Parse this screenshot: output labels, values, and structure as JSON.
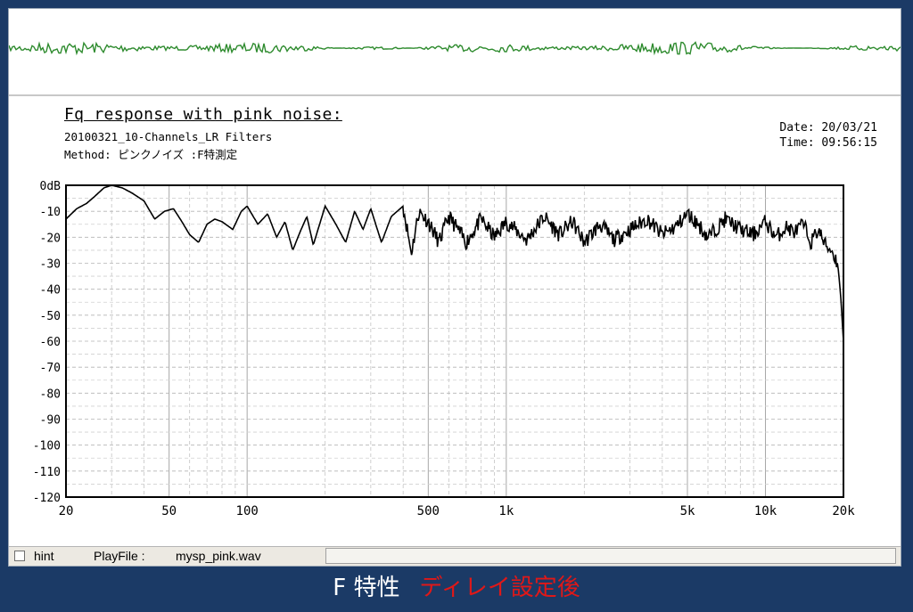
{
  "report": {
    "title": "Fq response with pink noise:",
    "subtitle": "20100321_10-Channels_LR Filters",
    "method": "Method: ピンクノイズ :F特測定",
    "date": "Date: 20/03/21",
    "time": "Time: 09:56:15"
  },
  "statusbar": {
    "hint_label": "hint",
    "playfile_label": "PlayFile :",
    "playfile_value": "mysp_pink.wav",
    "status_text": ""
  },
  "caption": {
    "main": "F 特性",
    "accent": "ディレイ設定後"
  },
  "colors": {
    "background": "#1b3a66",
    "waveform": "#2e8b2e",
    "curve": "#000000",
    "caption_main": "#ffffff",
    "caption_accent": "#e01818"
  },
  "chart_data": {
    "type": "line",
    "title": "Fq response with pink noise:",
    "xscale": "log",
    "xlim": [
      20,
      20000
    ],
    "ylim": [
      -120,
      0
    ],
    "grid": true,
    "yticks": [
      0,
      -10,
      -20,
      -30,
      -40,
      -50,
      -60,
      -70,
      -80,
      -90,
      -100,
      -110,
      -120
    ],
    "ytick_labels": [
      "0dB",
      "-10",
      "-20",
      "-30",
      "-40",
      "-50",
      "-60",
      "-70",
      "-80",
      "-90",
      "-100",
      "-110",
      "-120"
    ],
    "xticks": [
      20,
      50,
      100,
      500,
      1000,
      5000,
      10000,
      20000
    ],
    "xtick_labels": [
      "20",
      "50",
      "100",
      "500",
      "1k",
      "5k",
      "10k",
      "20k"
    ],
    "series": [
      {
        "x": [
          20,
          22,
          24,
          26,
          28,
          30,
          33,
          36,
          40,
          44,
          48,
          52,
          56,
          60,
          65,
          70,
          75,
          80,
          88,
          95,
          100,
          110,
          120,
          130,
          140,
          150,
          160,
          170,
          180,
          200,
          220,
          240,
          260,
          280,
          300,
          330,
          360,
          400,
          430,
          460,
          500,
          550,
          600,
          650,
          700,
          800,
          900,
          1000,
          1200,
          1400,
          1600,
          1800,
          2000,
          2300,
          2600,
          3000,
          3500,
          4000,
          4500,
          5000,
          5500,
          6000,
          7000,
          8000,
          9000,
          10000,
          11000,
          12000,
          13000,
          14000,
          15000,
          16000,
          17000,
          18000,
          19000,
          19500,
          20000
        ],
        "y": [
          -13,
          -9,
          -7,
          -4,
          -1,
          0,
          -1,
          -3,
          -6,
          -13,
          -10,
          -9,
          -14,
          -19,
          -22,
          -15,
          -13,
          -14,
          -17,
          -10,
          -8,
          -15,
          -11,
          -20,
          -14,
          -25,
          -18,
          -12,
          -23,
          -8,
          -15,
          -22,
          -10,
          -17,
          -9,
          -22,
          -12,
          -8,
          -26,
          -10,
          -14,
          -22,
          -12,
          -17,
          -22,
          -13,
          -20,
          -14,
          -21,
          -12,
          -19,
          -14,
          -22,
          -15,
          -21,
          -17,
          -13,
          -19,
          -16,
          -11,
          -15,
          -20,
          -13,
          -17,
          -19,
          -14,
          -20,
          -16,
          -18,
          -15,
          -22,
          -17,
          -23,
          -25,
          -30,
          -42,
          -60
        ]
      }
    ]
  }
}
